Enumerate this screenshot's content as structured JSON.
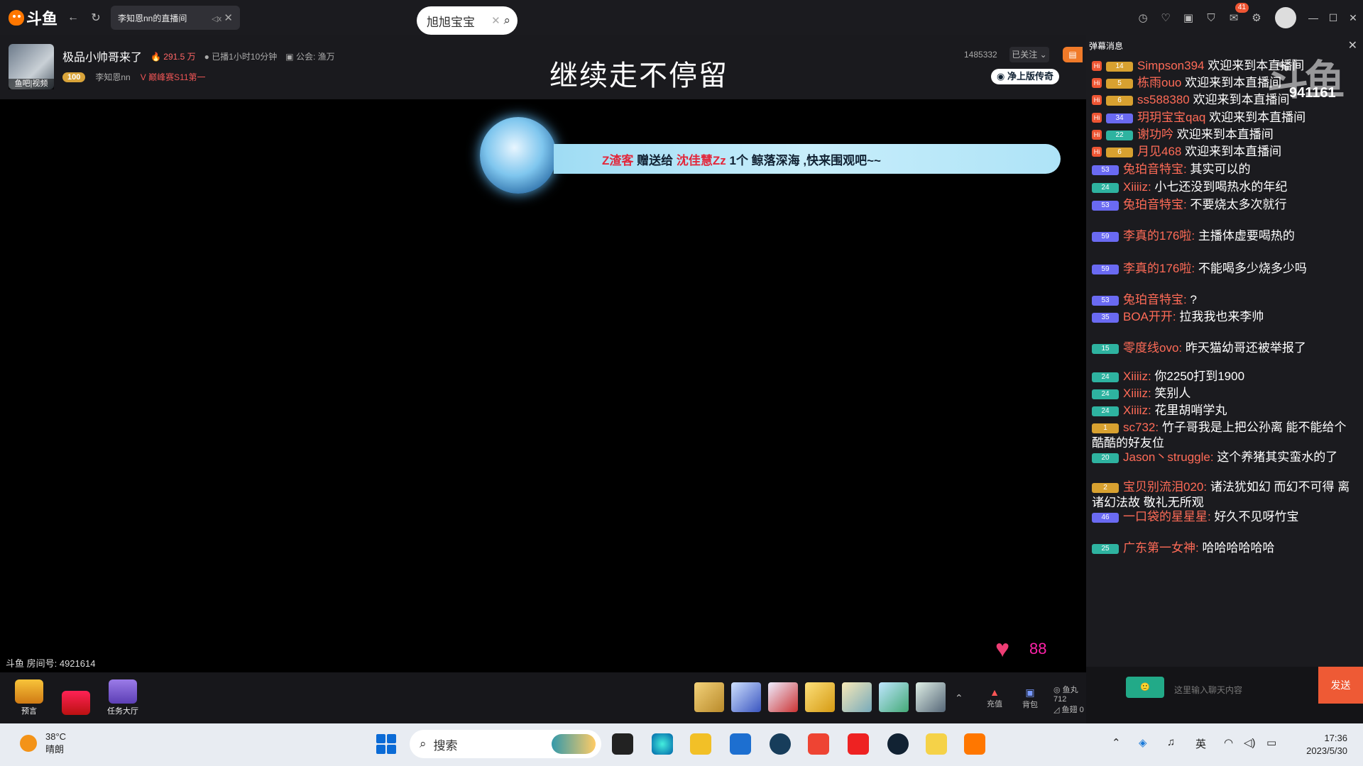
{
  "browser": {
    "tabs": [
      {
        "label": "旭旭宝宝"
      },
      {
        "label": "李知恩nn的直播间"
      }
    ],
    "notification_count": "41"
  },
  "room": {
    "title": "极品小帅哥来了",
    "hot": "291.5 万",
    "live_time": "已播1小时10分钟",
    "guild": "公会: 渔万",
    "avatar_caption": "鱼吧|视频",
    "level_badge": "100",
    "anchor_name": "李知恩nn",
    "rank": "巅峰赛S11第一",
    "fans": "1485332",
    "follow_label": "已关注",
    "center_title": "继续走不停留",
    "vip_label": "净上版传奇"
  },
  "gift_banner": {
    "sender": "Z渣客",
    "action": "赠送给",
    "receiver": "沈佳慧Zz",
    "gift": "1个 鲸落深海 ,快来围观吧~~"
  },
  "video": {
    "room_id": "斗鱼 房间号: 4921614",
    "heart_count": "88"
  },
  "bottom": {
    "items": [
      {
        "label": "预言"
      },
      {
        "label": ""
      },
      {
        "label": "任务大厅"
      }
    ],
    "recharge": "充值",
    "bag": "背包",
    "fish_ball_label": "鱼丸",
    "fish_ball_value": "712",
    "fish_wing_label": "鱼翅",
    "fish_wing_value": "0"
  },
  "chat": {
    "tab_label": "弹幕消息",
    "online": "941161",
    "input_placeholder": "这里输入聊天内容",
    "send_label": "发送",
    "msgs": [
      {
        "lvl": "14",
        "name": "Simpson394",
        "text": "欢迎来到本直播间"
      },
      {
        "lvl": "5",
        "name": "栋雨ouo",
        "text": "欢迎来到本直播间"
      },
      {
        "lvl": "6",
        "name": "ss588380",
        "text": "欢迎来到本直播间"
      },
      {
        "lvl": "34",
        "name": "玥玥宝宝qaq",
        "text": "欢迎来到本直播间"
      },
      {
        "lvl": "22",
        "name": "谢功吟",
        "text": "欢迎来到本直播间"
      },
      {
        "lvl": "6",
        "name": "月见468",
        "text": "欢迎来到本直播间"
      },
      {
        "lvl": "53",
        "name": "兔珀音特宝:",
        "text": "其实可以的"
      },
      {
        "lvl": "24",
        "name": "Xiiiiz:",
        "text": "小七还没到喝热水的年纪"
      },
      {
        "lvl": "53",
        "name": "兔珀音特宝:",
        "text": "不要烧太多次就行"
      },
      {
        "lvl": "59",
        "name": "李真的176啦:",
        "text": "主播体虚要喝热的"
      },
      {
        "lvl": "59",
        "name": "李真的176啦:",
        "text": "不能喝多少烧多少吗"
      },
      {
        "lvl": "53",
        "name": "兔珀音特宝:",
        "text": "?"
      },
      {
        "lvl": "35",
        "name": "BOA开开:",
        "text": "拉我我也来李帅"
      },
      {
        "lvl": "15",
        "name": "零度线ovo:",
        "text": "昨天猫幼哥还被举报了"
      },
      {
        "lvl": "24",
        "name": "Xiiiiz:",
        "text": "你2250打到1900"
      },
      {
        "lvl": "24",
        "name": "Xiiiiz:",
        "text": "笑别人"
      },
      {
        "lvl": "24",
        "name": "Xiiiiz:",
        "text": "花里胡哨学丸"
      },
      {
        "lvl": "1",
        "name": "sc732:",
        "text": "竹子哥我是上把公孙离 能不能给个酷酷的好友位"
      },
      {
        "lvl": "20",
        "name": "Jason丶struggle:",
        "text": "这个养猪其实蛮水的了"
      },
      {
        "lvl": "2",
        "name": "宝贝别流泪020:",
        "text": "诸法犹如幻 而幻不可得 离诸幻法故 敬礼无所观"
      },
      {
        "lvl": "46",
        "name": "一口袋的星星星:",
        "text": "好久不见呀竹宝"
      },
      {
        "lvl": "25",
        "name": "广东第一女神:",
        "text": "哈哈哈哈哈哈"
      }
    ]
  },
  "taskbar": {
    "temp": "38°C",
    "weather": "晴朗",
    "search": "搜索",
    "ime": "英",
    "time": "17:36",
    "date": "2023/5/30"
  }
}
